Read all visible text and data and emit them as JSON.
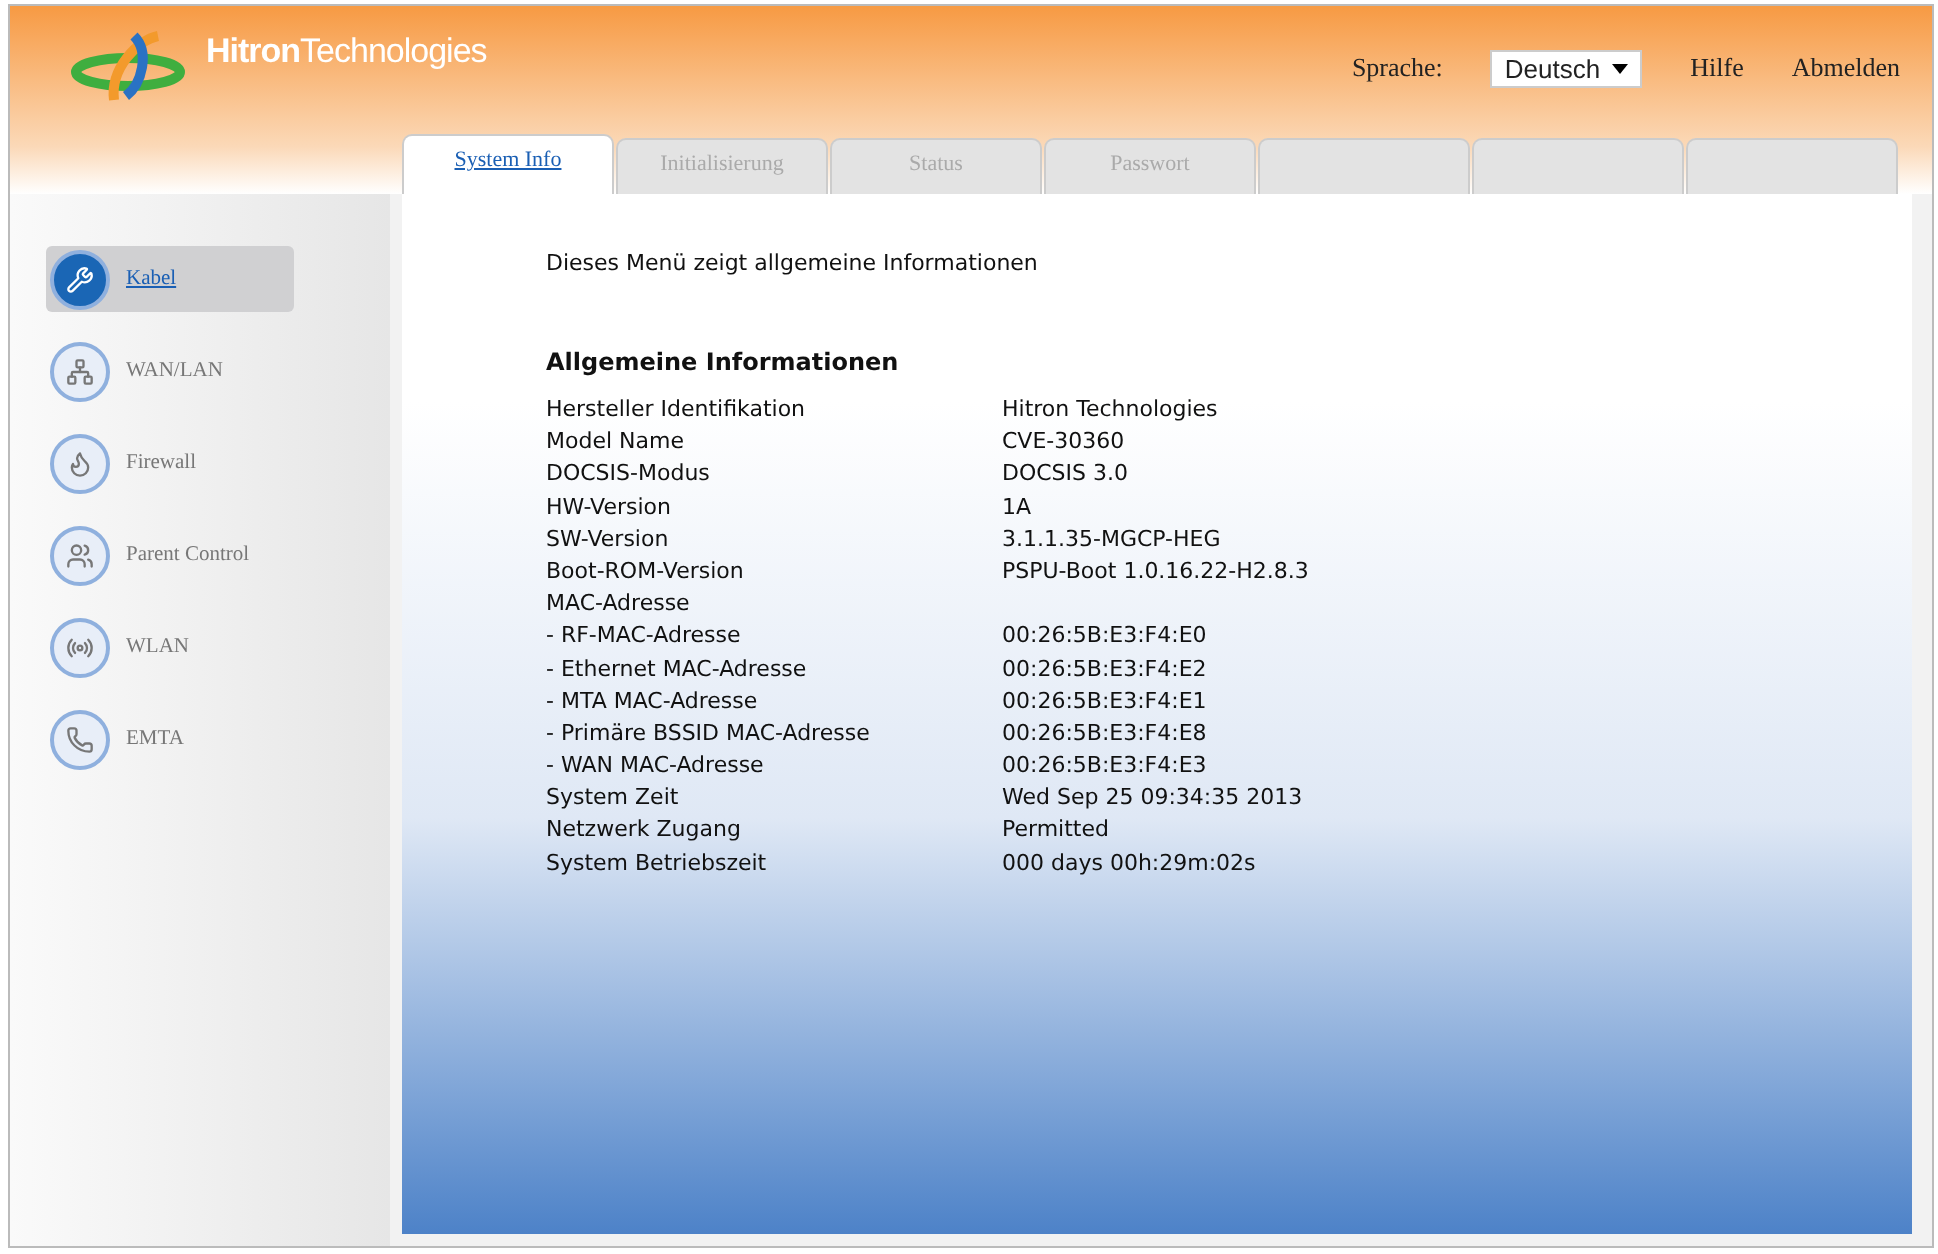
{
  "header": {
    "logo": "**Hitron**Technologies",
    "language_label": "Sprache:",
    "language_select": "Deutsch",
    "links": [
      "Hilfe",
      "Abmelden"
    ]
  },
  "tabs": [
    {
      "label": "System Info",
      "selected": true
    },
    {
      "label": "Initialisierung",
      "selected": false
    },
    {
      "label": "Status",
      "selected": false
    },
    {
      "label": "Passwort",
      "selected": false
    }
  ],
  "sidebar": {
    "items": [
      {
        "label": "Kabel",
        "selected": true
      },
      {
        "label": "WAN/LAN",
        "selected": false
      },
      {
        "label": "Firewall",
        "selected": false
      },
      {
        "label": "Parent Control",
        "selected": false
      },
      {
        "label": "WLAN",
        "selected": false
      },
      {
        "label": "EMTA",
        "selected": false
      }
    ]
  },
  "content": {
    "intro": "Dieses Menü zeigt allgemeine Informationen",
    "heading": "Allgemeine Informationen",
    "rows": [
      {
        "label": "Hersteller Identifikation",
        "value": "Hitron Technologies"
      },
      {
        "label": "Model Name",
        "value": "CVE-30360"
      },
      {
        "label": "DOCSIS-Modus",
        "value": "DOCSIS 3.0"
      },
      {
        "label": "HW-Version",
        "value": "1A"
      },
      {
        "label": "SW-Version",
        "value": "3.1.1.35-MGCP-HEG"
      },
      {
        "label": "Boot-ROM-Version",
        "value": "PSPU-Boot 1.0.16.22-H2.8.3"
      },
      {
        "label": "MAC-Adresse"
      },
      {
        "label": "- RF-MAC-Adresse",
        "value": "00:26:5B:E3:F4:E0"
      },
      {
        "label": "- Ethernet MAC-Adresse",
        "value": "00:26:5B:E3:F4:E2"
      },
      {
        "label": "- MTA MAC-Adresse",
        "value": "00:26:5B:E3:F4:E1"
      },
      {
        "label": "- Primäre BSSID MAC-Adresse",
        "value": "00:26:5B:E3:F4:E8"
      },
      {
        "label": "- WAN MAC-Adresse",
        "value": "00:26:5B:E3:F4:E3"
      },
      {
        "label": "System Zeit",
        "value": "Wed Sep 25 09:34:35 2013"
      },
      {
        "label": "Netzwerk Zugang",
        "value": "Permitted"
      },
      {
        "label": "System Betriebszeit",
        "value": "000 days 00h:29m:02s"
      }
    ]
  }
}
